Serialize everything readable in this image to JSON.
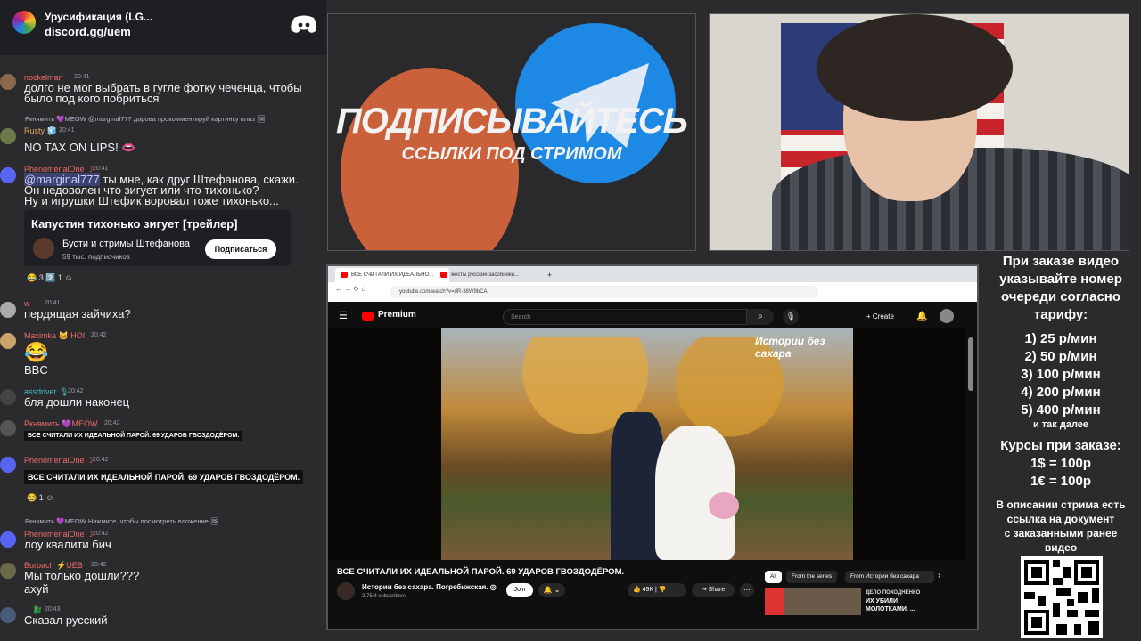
{
  "discord": {
    "server_name": "Урусификация (LG...",
    "invite": "discord.gg/uem",
    "messages": [
      {
        "user": "nockelman",
        "time": "20:41",
        "text1": "долго не мог выбрать в гугле фотку чеченца, чтобы",
        "text2": "было под кого побриться"
      },
      {
        "reply": "Ркнямить 💜MEOW @marginal777 дарова прокомментируй картинку плиз 🖼"
      },
      {
        "user": "Rusty 🧊",
        "time": "20:41",
        "text1": "NO TAX ON LIPS! 👄"
      },
      {
        "user": "PhenomenalOne ☽",
        "time": "20:41",
        "mention": "@marginal777",
        "text1": " ты мне, как друг Штефанова, скажи.",
        "text2": "Он недоволен что зигует или что тихонько?",
        "text3": "Ну и игрушки Штефик воровал тоже тихонько..."
      },
      {
        "user": "w",
        "time": "20:41",
        "text1": "пердящая зайчиха?"
      },
      {
        "user": "Maximka 🐱 HOI",
        "time": "20:42",
        "emoji": "😂",
        "text1": "BBC"
      },
      {
        "user": "assdriver 🎙",
        "time": "20:42",
        "text1": "бля дошли наконец"
      },
      {
        "user": "Ркнямить 💜MEOW",
        "time": "20:42",
        "caption": "ВСЕ СЧИТАЛИ ИХ ИДЕАЛЬНОЙ ПАРОЙ. 69 УДАРОВ ГВОЗДОДЁРОМ."
      },
      {
        "user": "PhenomenalOne ☽",
        "time": "20:42",
        "caption": "ВСЕ СЧИТАЛИ ИХ ИДЕАЛЬНОЙ ПАРОЙ. 69 УДАРОВ ГВОЗДОДЁРОМ."
      },
      {
        "reply": "Ркнямить 💜MEOW Нажмите, чтобы посмотреть вложение 🖼"
      },
      {
        "user": "PhenomenalOne ☽",
        "time": "20:42",
        "text1": "лоу квалити бич"
      },
      {
        "user": "Burbach ⚡UEB",
        "time": "20:42",
        "text1": "Мы только дошли???",
        "text2": "ахуй"
      },
      {
        "user": "🐉",
        "time": "20:43",
        "text1": "Сказал русский"
      }
    ],
    "embed": {
      "title": "Капустин тихонько зигует [трейлер]",
      "channel": "Бусти и стримы Штефанова",
      "subs": "59 тыс. подписчиков",
      "button": "Подписаться"
    },
    "reactions1": "😂 3   2️⃣ 1   ☺",
    "reactions2": "😂 1   ☺"
  },
  "banner": {
    "title": "ПОДПИСЫВАЙТЕСЬ",
    "subtitle": "ССЫЛКИ ПОД СТРИМОМ"
  },
  "browser": {
    "tab1": "ВСЕ СЧИТАЛИ ИХ ИДЕАЛЬНО...",
    "tab2": "жесты русские засобники...",
    "url": "youtube.com/watch?v=dR-38W9bCA",
    "yt_brand": "Premium",
    "search_placeholder": "Search",
    "create": "+ Create",
    "video_watermark": "Истории без сахара",
    "video_title": "ВСЕ СЧИТАЛИ ИХ ИДЕАЛЬНОЙ ПАРОЙ. 69 УДАРОВ ГВОЗДОДЁРОМ.",
    "channel_name": "Истории без сахара. Погребижская. ◎",
    "channel_subs": "2.75M subscribers",
    "join": "Join",
    "bell": "🔔 ⌄",
    "likes": "👍 49K  |  👎",
    "share": "↪ Share",
    "more": "⋯",
    "chips": [
      "All",
      "From the series",
      "From Истории без сахара"
    ],
    "rec_title1": "ДЕЛО ПОХОДНЕНКО",
    "rec_title2": "ИХ УБИЛИ",
    "rec_title3": "МОЛОТКАМИ. ..."
  },
  "info": {
    "lines": [
      "При заказе видео",
      "указывайте номер",
      "очереди согласно",
      "тарифу:",
      "1) 25 р/мин",
      "2) 50 р/мин",
      "3) 100 р/мин",
      "4) 200 р/мин",
      "5) 400 р/мин",
      "и так далее",
      "Курсы при заказе:",
      "1$ = 100р",
      "1€ = 100р",
      "В описании стрима есть",
      "ссылка на документ",
      "с заказанными ранее",
      "видео"
    ]
  }
}
